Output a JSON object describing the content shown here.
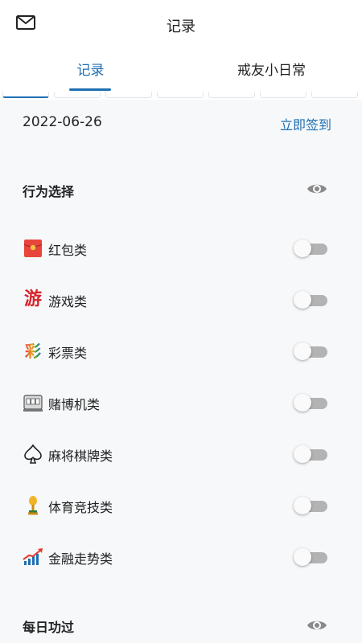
{
  "header": {
    "title": "记录",
    "mail_icon": "mail-icon"
  },
  "tabs": [
    {
      "label": "记录",
      "active": true
    },
    {
      "label": "戒友小日常",
      "active": false
    }
  ],
  "date_row": {
    "date": "2022-06-26",
    "signin_label": "立即签到"
  },
  "behavior_section": {
    "title": "行为选择",
    "visibility_icon": "eye-icon",
    "items": [
      {
        "label": "红包类",
        "icon": "red-envelope-icon",
        "enabled": false
      },
      {
        "label": "游戏类",
        "icon": "game-char-icon",
        "enabled": false
      },
      {
        "label": "彩票类",
        "icon": "lottery-char-icon",
        "enabled": false
      },
      {
        "label": "赌博机类",
        "icon": "slot-machine-icon",
        "enabled": false
      },
      {
        "label": "麻将棋牌类",
        "icon": "spade-icon",
        "enabled": false
      },
      {
        "label": "体育竞技类",
        "icon": "trophy-icon",
        "enabled": false
      },
      {
        "label": "金融走势类",
        "icon": "trend-chart-icon",
        "enabled": false
      }
    ]
  },
  "daily_section": {
    "title": "每日功过",
    "visibility_icon": "eye-icon"
  },
  "colors": {
    "accent": "#1d6fb3",
    "background": "#f7f8fa",
    "toggle_off": "#b3b3b3"
  }
}
